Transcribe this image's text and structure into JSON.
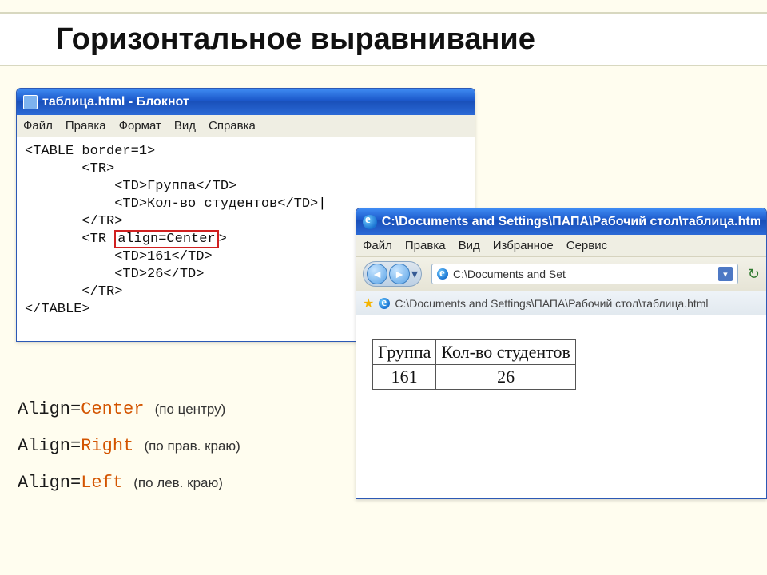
{
  "slide": {
    "title": "Горизонтальное выравнивание"
  },
  "notepad": {
    "window_title": "таблица.html - Блокнот",
    "menus": [
      "Файл",
      "Правка",
      "Формат",
      "Вид",
      "Справка"
    ],
    "code": {
      "l1": "<TABLE border=1>",
      "l2": "       <TR>",
      "l3": "           <TD>Группа</TD>",
      "l4_a": "           <TD>Кол-во студентов</TD>",
      "l4_b": "|",
      "l5": "       </TR>",
      "l6_a": "       <TR ",
      "l6_hl": "align=Center",
      "l6_b": ">",
      "l7": "           <TD>161</TD>",
      "l8": "           <TD>26</TD>",
      "l9": "       </TR>",
      "l10": "</TABLE>"
    }
  },
  "ie": {
    "window_title": "C:\\Documents and Settings\\ПАПА\\Рабочий стол\\таблица.html",
    "menus": [
      "Файл",
      "Правка",
      "Вид",
      "Избранное",
      "Сервис"
    ],
    "address_short": "C:\\Documents and Set",
    "linkbar_text": "C:\\Documents and Settings\\ПАПА\\Рабочий стол\\таблица.html",
    "table": {
      "h1": "Группа",
      "h2": "Кол-во студентов",
      "c1": "161",
      "c2": "26"
    }
  },
  "legend": {
    "r1_a": "Align=",
    "r1_kw": "Center",
    "r1_note": "(по центру)",
    "r2_a": "Align=",
    "r2_kw": "Right",
    "r2_note": "(по прав. краю)",
    "r3_a": "Align=",
    "r3_kw": "Left",
    "r3_note": "(по лев. краю)"
  }
}
